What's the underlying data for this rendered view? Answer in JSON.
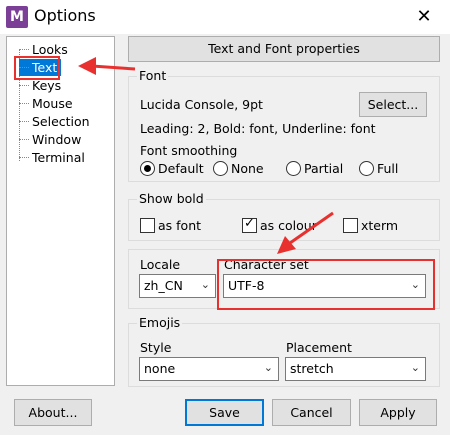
{
  "window": {
    "title": "Options",
    "app_icon_letter": "M",
    "close_glyph": "✕"
  },
  "tree": {
    "items": [
      "Looks",
      "Text",
      "Keys",
      "Mouse",
      "Selection",
      "Window",
      "Terminal"
    ],
    "selected": "Text"
  },
  "panel_heading": "Text and Font properties",
  "font_group": {
    "label": "Font",
    "font_name": "Lucida Console, 9pt",
    "select_button": "Select...",
    "details": "Leading: 2, Bold: font, Underline: font",
    "smoothing_label": "Font smoothing",
    "smoothing_options": [
      "Default",
      "None",
      "Partial",
      "Full"
    ],
    "smoothing_selected": "Default"
  },
  "bold_group": {
    "label": "Show bold",
    "options": [
      {
        "label": "as font",
        "checked": false
      },
      {
        "label": "as colour",
        "checked": true
      },
      {
        "label": "xterm",
        "checked": false
      }
    ]
  },
  "locale": {
    "label": "Locale",
    "value": "zh_CN"
  },
  "charset": {
    "label": "Character set",
    "value": "UTF-8"
  },
  "emojis_group": {
    "label": "Emojis",
    "style_label": "Style",
    "style_value": "none",
    "placement_label": "Placement",
    "placement_value": "stretch"
  },
  "buttons": {
    "about": "About...",
    "save": "Save",
    "cancel": "Cancel",
    "apply": "Apply"
  },
  "annotation_color": "#e8312f"
}
